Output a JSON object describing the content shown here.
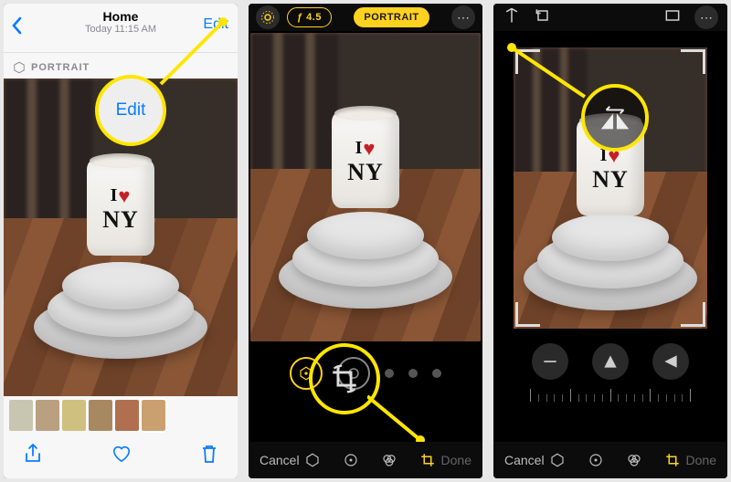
{
  "screen1": {
    "header": {
      "title": "Home",
      "subtitle": "Today 11:15 AM",
      "edit_label": "Edit"
    },
    "badge_label": "PORTRAIT",
    "callout_label": "Edit",
    "cup": {
      "line1_prefix": "I",
      "line2": "NY"
    }
  },
  "screen2": {
    "topbar": {
      "aperture_label": "ƒ 4.5",
      "mode_badge": "PORTRAIT"
    },
    "bottom": {
      "cancel_label": "Cancel",
      "done_label": "Done"
    },
    "cup": {
      "line1_prefix": "I",
      "line2": "NY"
    }
  },
  "screen3": {
    "bottom": {
      "cancel_label": "Cancel",
      "done_label": "Done"
    },
    "cup": {
      "line1_prefix": "I",
      "line2": "NY"
    }
  }
}
